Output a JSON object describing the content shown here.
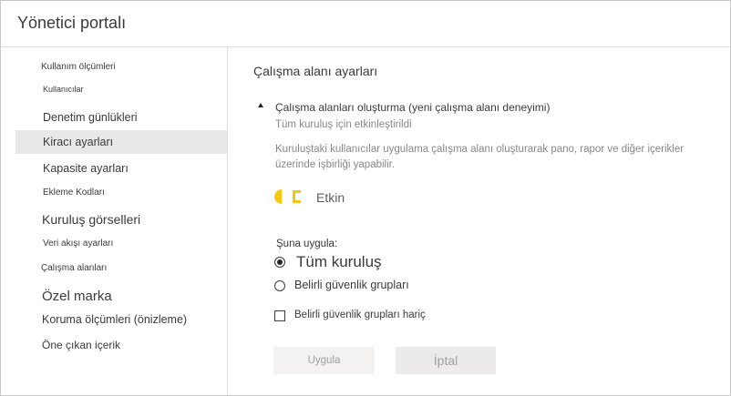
{
  "header": {
    "title": "Yönetici portalı"
  },
  "sidebar": {
    "items": [
      {
        "label": "Kullanım ölçümleri"
      },
      {
        "label": "Kullanıcılar"
      },
      {
        "label": "Denetim günlükleri"
      },
      {
        "label": "Kiracı ayarları",
        "selected": true
      },
      {
        "label": "Kapasite ayarları"
      },
      {
        "label": "Ekleme Kodları"
      },
      {
        "label": "Kuruluş görselleri"
      },
      {
        "label": "Veri akışı ayarları"
      },
      {
        "label": "Çalışma alanları"
      },
      {
        "label": "Özel marka"
      },
      {
        "label": "Koruma ölçümleri (önizleme)"
      },
      {
        "label": "Öne çıkan içerik"
      }
    ]
  },
  "main": {
    "section_title": "Çalışma alanı ayarları",
    "setting": {
      "name": "Çalışma alanları oluşturma (yeni çalışma alanı deneyimi)",
      "status": "Tüm kuruluş için etkinleştirildi",
      "description": "Kuruluştaki kullanıcılar uygulama çalışma alanı oluşturarak pano, rapor ve diğer içerikler üzerinde işbirliği yapabilir.",
      "toggle": {
        "label": "Etkin",
        "on": true,
        "color": "#f2c811"
      },
      "apply_to_label": "Şuna uygula:",
      "options": [
        {
          "label": "Tüm kuruluş",
          "checked": true
        },
        {
          "label": "Belirli güvenlik grupları",
          "checked": false
        }
      ],
      "except_label": "Belirli güvenlik grupları hariç",
      "except_checked": false
    },
    "buttons": {
      "apply": "Uygula",
      "cancel": "İptal"
    }
  }
}
